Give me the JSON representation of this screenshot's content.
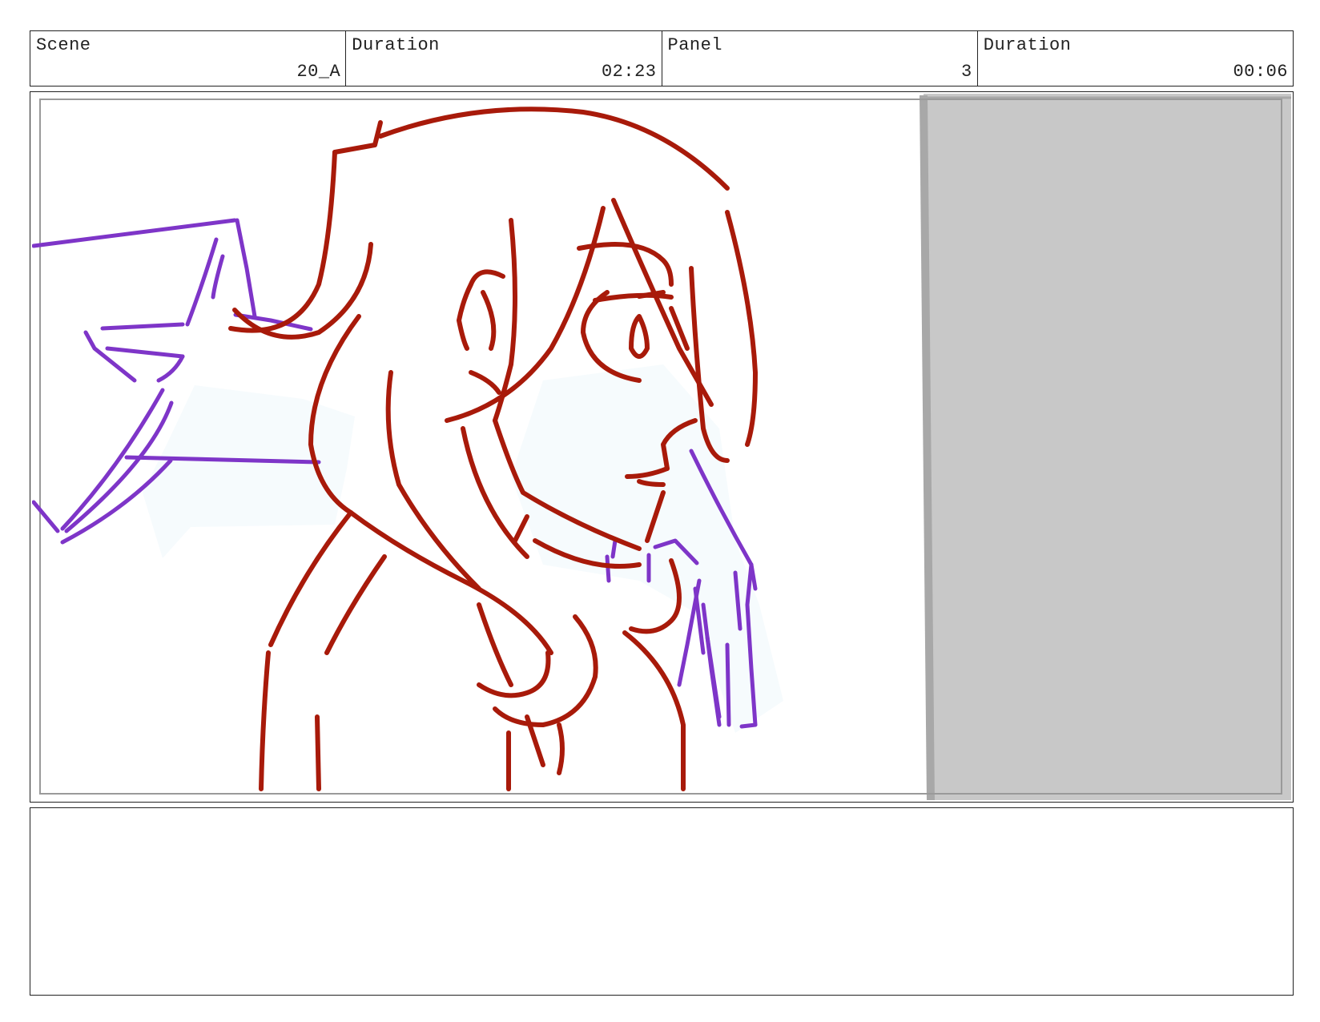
{
  "header": {
    "scene": {
      "label": "Scene",
      "value": "20_A"
    },
    "scene_duration": {
      "label": "Duration",
      "value": "02:23"
    },
    "panel": {
      "label": "Panel",
      "value": "3"
    },
    "panel_duration": {
      "label": "Duration",
      "value": "00:06"
    }
  },
  "panel_image": {
    "colors": {
      "line_red": "#a81a0a",
      "line_purple": "#7e35c8",
      "skin_fill": "#f6fbfd",
      "overlay_gray": "#c8c8c8",
      "overlay_edge": "#a8a8a8",
      "safe_frame": "#9a9a9a"
    }
  },
  "notes": {
    "text": ""
  }
}
